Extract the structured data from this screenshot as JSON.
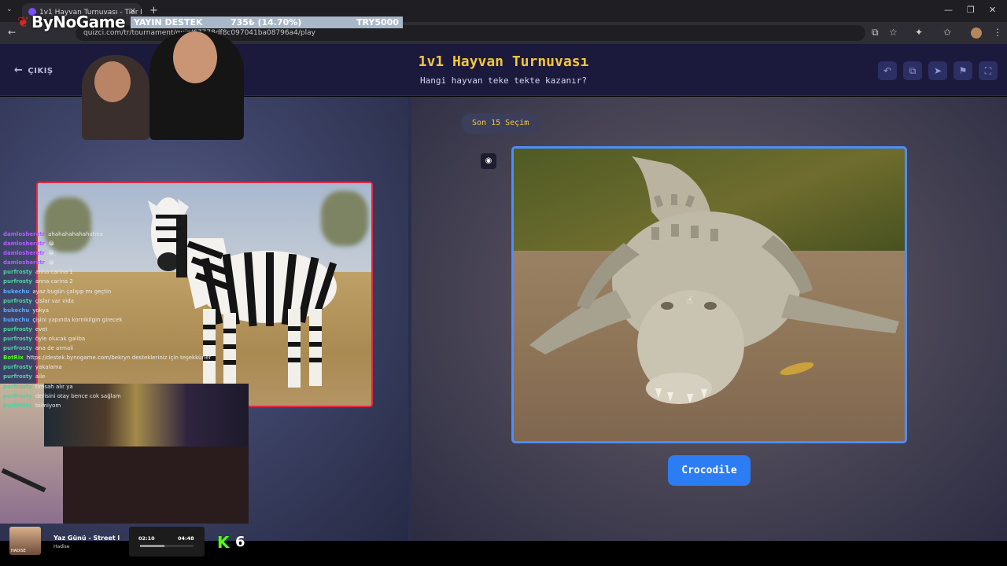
{
  "browser": {
    "tab_title": "1v1 Hayvan Turnuvası - Tier List",
    "url": "quizci.com/tr/tournament/quiz/67778df8c097041ba08796a4/play"
  },
  "overlay": {
    "logo": "ByNoGame",
    "banner": {
      "label": "YAYIN DESTEK",
      "amount": "735₺ (14.70%)",
      "goal": "TRY5000"
    }
  },
  "header": {
    "exit_label": "ÇIKIŞ",
    "title": "1v1 Hayvan Turnuvası",
    "subtitle": "Hangi hayvan teke tekte kazanır?"
  },
  "round_badge": "Son 15 Seçim",
  "choice_right_label": "Crocodile",
  "chat": [
    {
      "user": "damlosheretr",
      "msg": "ahahahahahahahna",
      "color": "#b35cff"
    },
    {
      "user": "damlosheretr",
      "msg": "😭",
      "color": "#b35cff"
    },
    {
      "user": "damlosheretr",
      "msg": "😭",
      "color": "#b35cff"
    },
    {
      "user": "damlosheretr",
      "msg": "😭",
      "color": "#b35cff"
    },
    {
      "user": "purfrosty",
      "msg": "anna carina 1",
      "color": "#4fd1a0"
    },
    {
      "user": "purfrosty",
      "msg": "anna carina 2",
      "color": "#4fd1a0"
    },
    {
      "user": "bukechu",
      "msg": "ayaz bugün çalışıp mı geçtin",
      "color": "#5aa9ff"
    },
    {
      "user": "purfrosty",
      "msg": "çislar var vida",
      "color": "#4fd1a0"
    },
    {
      "user": "bukechu",
      "msg": "yokya",
      "color": "#5aa9ff"
    },
    {
      "user": "bukechu",
      "msg": "çişini yapında kornikilgin girecek",
      "color": "#5aa9ff"
    },
    {
      "user": "purfrosty",
      "msg": "evet",
      "color": "#4fd1a0"
    },
    {
      "user": "purfrosty",
      "msg": "öyle olucak galiba",
      "color": "#4fd1a0"
    },
    {
      "user": "purfrosty",
      "msg": "ana de armali",
      "color": "#4fd1a0"
    },
    {
      "user": "BotRix",
      "msg": "https://destek.bynogame.com/bekryn destekleriniz için teşekkürler",
      "color": "#53fc18"
    },
    {
      "user": "purfrosty",
      "msg": "yakalama",
      "color": "#4fd1a0"
    },
    {
      "user": "purfrosty",
      "msg": "aile",
      "color": "#4fd1a0"
    },
    {
      "user": "purfrosty",
      "msg": "timsah alır ya",
      "color": "#4fd1a0"
    },
    {
      "user": "purfrosty",
      "msg": "derisini otay bence cok sağlam",
      "color": "#4fd1a0"
    },
    {
      "user": "purfrosty",
      "msg": "bilmiyom",
      "color": "#4fd1a0"
    }
  ],
  "music": {
    "song": "Yaz Günü - Street l",
    "artist": "Hadise",
    "album_caption": "HADISE",
    "elapsed": "02:10",
    "total": "04:48",
    "progress": 0.45
  },
  "kick": {
    "logo": "K",
    "count": "6"
  },
  "colors": {
    "accent_title": "#f5c63b",
    "left_border": "#e02a47",
    "right_border": "#4c8dff",
    "answer_button": "#2c7cf4"
  }
}
